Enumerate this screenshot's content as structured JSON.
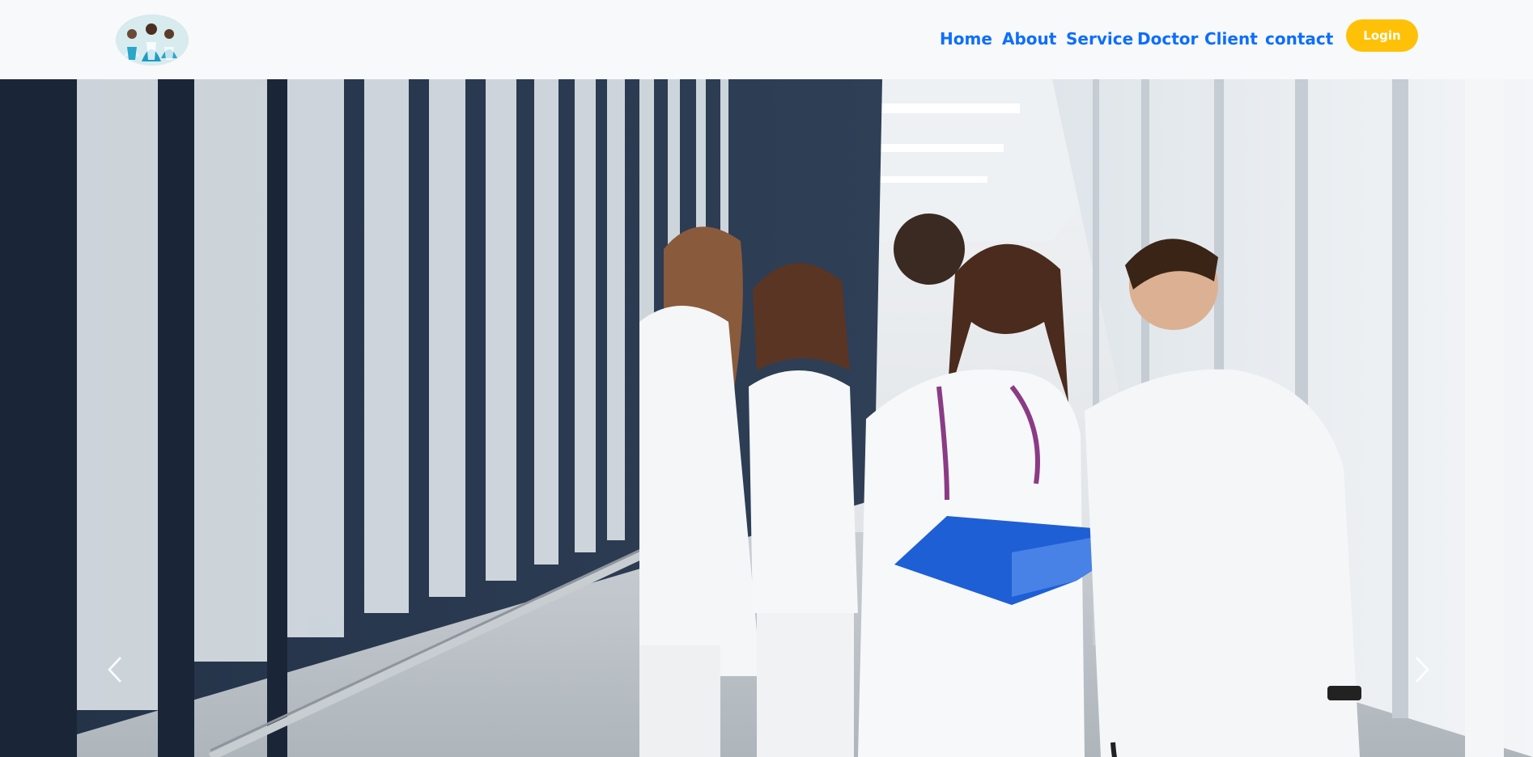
{
  "navbar": {
    "logo_icon": "doctors-group-logo",
    "links": [
      "Home",
      "About",
      "Service",
      "Doctor",
      "Client",
      "contact"
    ],
    "login_label": "Login"
  },
  "hero": {
    "image": "medical-team-in-hospital-corridor-photo",
    "prev_icon": "chevron-left-icon",
    "next_icon": "chevron-right-icon"
  },
  "colors": {
    "nav_link": "#0d6efd",
    "login_bg": "#ffc107",
    "navbar_bg": "#f8f9fa"
  }
}
